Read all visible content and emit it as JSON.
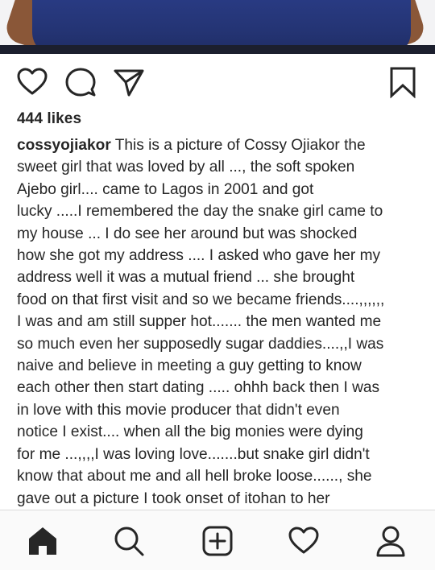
{
  "post": {
    "likes_label": "444 likes",
    "username": "cossyojiakor",
    "caption_lines": [
      "This is a picture of Cossy Ojiakor the",
      "sweet girl that was loved by all ..., the soft spoken",
      "Ajebo girl.... came to Lagos in 2001  and got",
      "lucky .....I remembered the day the snake girl came to",
      "my house ... I do see her around but was shocked",
      "how she got my address .... I asked who gave her my",
      "address well it was a mutual friend ... she brought",
      "food on that first visit and so we became friends....,,,,,,",
      "I was and am still supper hot....... the men wanted me",
      "so much even her supposedly sugar daddies....,,I was",
      "naive and believe in meeting a guy getting to know",
      "each other then start dating ..... ohhh back then I was",
      "in love with this movie producer that didn't even",
      "notice I exist.... when all the big monies were dying",
      "for me ...,,,,I was loving love.......but snake girl didn't",
      "know that about me and all hell broke loose......, she",
      "gave out a  picture I took onset of itohan to her"
    ]
  },
  "actions": {
    "like_icon": "heart-outline",
    "comment_icon": "speech-bubble",
    "share_icon": "paper-plane",
    "save_icon": "bookmark-outline"
  },
  "bottom_nav": {
    "items": [
      "home-icon",
      "search-icon",
      "create-post-icon",
      "activity-icon",
      "profile-icon"
    ]
  },
  "colors": {
    "text": "#262626",
    "icon": "#262626",
    "nav_background": "#fafafa",
    "divider": "#1c1f2e"
  }
}
